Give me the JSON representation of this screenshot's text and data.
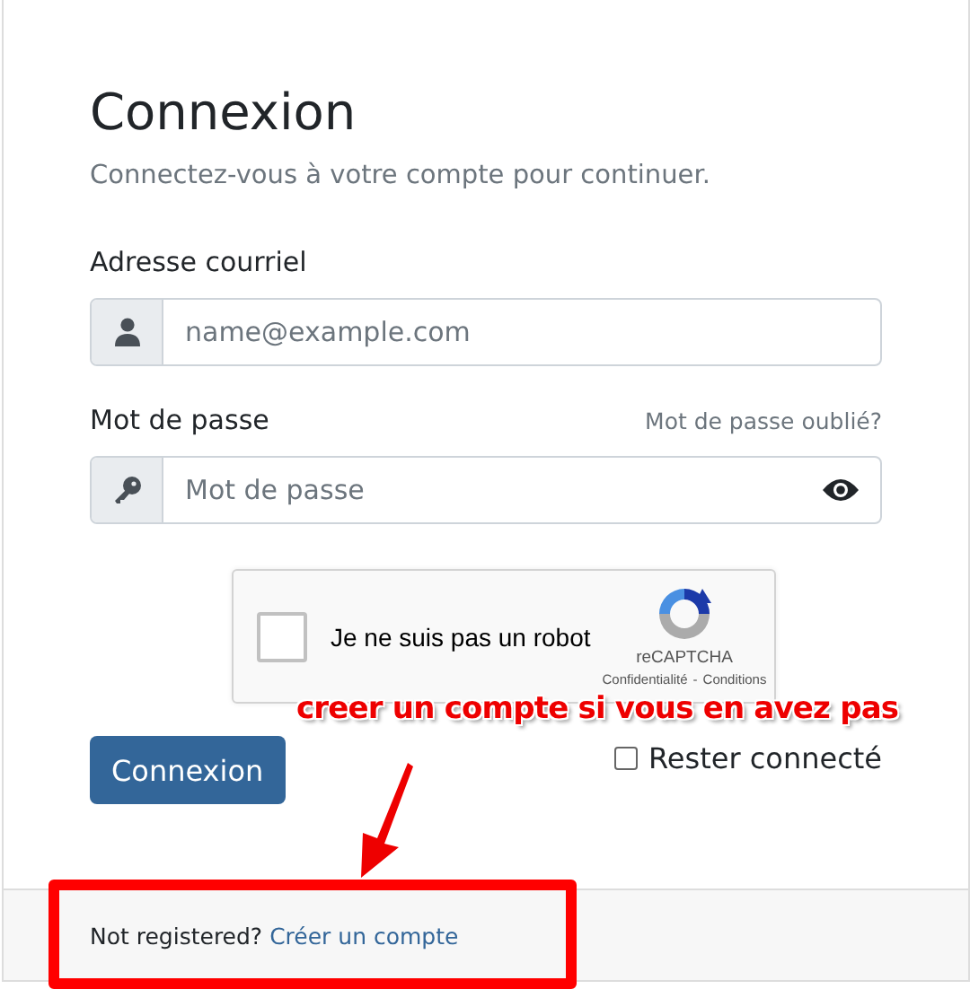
{
  "title": "Connexion",
  "subtitle": "Connectez-vous à votre compte pour continuer.",
  "email": {
    "label": "Adresse courriel",
    "placeholder": "name@example.com"
  },
  "password": {
    "label": "Mot de passe",
    "forgot_link": "Mot de passe oublié?",
    "placeholder": "Mot de passe"
  },
  "captcha": {
    "checked": false,
    "label": "Je ne suis pas un robot",
    "brand": "reCAPTCHA",
    "privacy": "Confidentialité",
    "separator": "-",
    "terms": "Conditions"
  },
  "submit": "Connexion",
  "remember": {
    "label": "Rester connecté",
    "checked": false
  },
  "footer": {
    "prompt": "Not registered?",
    "link": "Créer un compte"
  },
  "annotation": {
    "text": "creer un compte si vous en avez pas"
  }
}
